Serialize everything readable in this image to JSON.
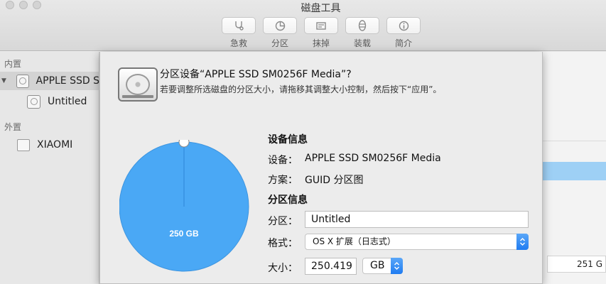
{
  "window": {
    "title": "磁盘工具"
  },
  "toolbar": [
    {
      "label": "急救",
      "icon": "stethoscope-icon"
    },
    {
      "label": "分区",
      "icon": "partition-icon"
    },
    {
      "label": "抹掉",
      "icon": "erase-icon"
    },
    {
      "label": "装载",
      "icon": "mount-icon"
    },
    {
      "label": "简介",
      "icon": "info-icon"
    }
  ],
  "sidebar": {
    "internal_label": "内置",
    "external_label": "外置",
    "items": [
      {
        "label": "APPLE SSD S",
        "icon": "disk-icon"
      },
      {
        "label": "Untitled",
        "icon": "volume-icon"
      },
      {
        "label": "XIAOMI",
        "icon": "external-disk-icon"
      }
    ]
  },
  "background": {
    "size_value": "251 G"
  },
  "sheet": {
    "title": "分区设备“APPLE SSD SM0256F Media”?",
    "description": "若要调整所选磁盘的分区大小，请拖移其调整大小控制，然后按下“应用”。",
    "pie": {
      "label": "250 GB"
    },
    "device_info": {
      "heading": "设备信息",
      "device_label": "设备：",
      "device_value": "APPLE SSD SM0256F Media",
      "scheme_label": "方案：",
      "scheme_value": "GUID 分区图"
    },
    "partition_info": {
      "heading": "分区信息",
      "partition_label": "分区：",
      "partition_value": "Untitled",
      "format_label": "格式：",
      "format_value": "OS X 扩展（日志式）",
      "size_label": "大小：",
      "size_value": "250.419",
      "unit_value": "GB"
    }
  },
  "colors": {
    "accent": "#1f7cf1",
    "pie": "#4aa8f5",
    "selection": "#9ed0f5"
  }
}
